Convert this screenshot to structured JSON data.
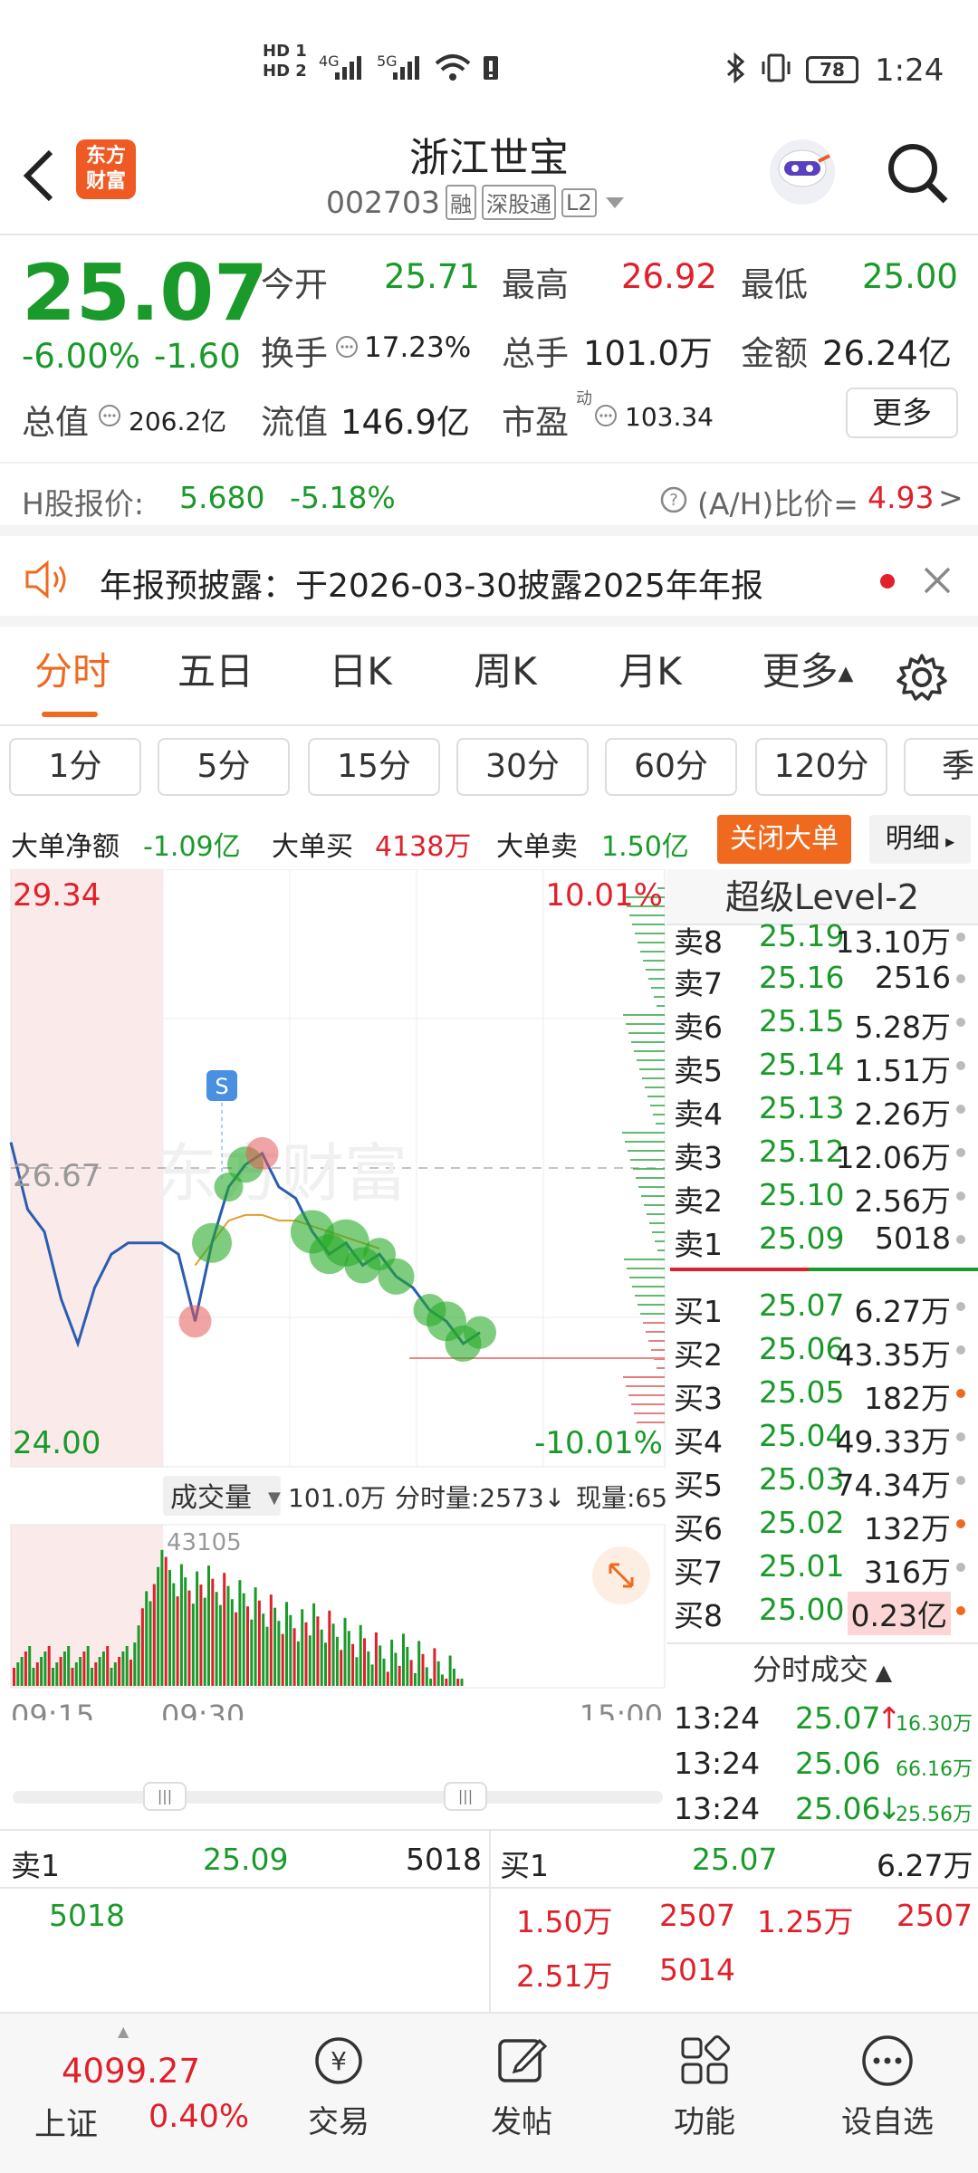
{
  "status": {
    "hd1": "HD 1",
    "hd2": "HD 2",
    "net1": "4G",
    "net2": "5G",
    "battery": "78",
    "time": "1:24"
  },
  "header": {
    "logo_line1": "东方",
    "logo_line2": "财富",
    "stock_name": "浙江世宝",
    "stock_code": "002703",
    "tag_margin": "融",
    "tag_connect": "深股通",
    "tag_level": "L2"
  },
  "quote": {
    "price": "25.07",
    "change_pct": "-6.00%",
    "change": "-1.60",
    "open_label": "今开",
    "open": "25.71",
    "high_label": "最高",
    "high": "26.92",
    "low_label": "最低",
    "low": "25.00",
    "turnover_label": "换手",
    "turnover": "17.23%",
    "volume_label": "总手",
    "volume": "101.0万",
    "amount_label": "金额",
    "amount": "26.24亿",
    "mktcap_label": "总值",
    "mktcap": "206.2亿",
    "float_label": "流值",
    "float": "146.9亿",
    "pe_label": "市盈",
    "pe_sup": "动",
    "pe": "103.34",
    "more_button": "更多"
  },
  "hshare": {
    "label": "H股报价:",
    "price": "5.680",
    "change_pct": "-5.18%",
    "ah_label": "(A/H)比价=",
    "ah_value": "4.93",
    "arrow": ">"
  },
  "notice": {
    "text": "年报预披露：于2026-03-30披露2025年年报"
  },
  "tabs": [
    "分时",
    "五日",
    "日K",
    "周K",
    "月K",
    "更多"
  ],
  "periods": [
    "1分",
    "5分",
    "15分",
    "30分",
    "60分",
    "120分",
    "季"
  ],
  "bigorder": {
    "net_label": "大单净额",
    "net": "-1.09亿",
    "buy_label": "大单买",
    "buy": "4138万",
    "sell_label": "大单卖",
    "sell": "1.50亿",
    "close_button": "关闭大单",
    "detail_button": "明细"
  },
  "chart": {
    "price_top": "29.34",
    "price_bottom": "24.00",
    "price_prev": "26.67",
    "pct_top": "10.01%",
    "pct_bottom": "-10.01%",
    "signal": "S",
    "watermark": "东方财富",
    "vol_label": "成交量",
    "vol_total": "101.0万",
    "vol_tick": "分时量:2573↓",
    "vol_now": "现量:65",
    "vol_max": "43105",
    "time_start": "09:15",
    "time_mid": "09:30",
    "time_end": "15:00",
    "colors": {
      "up": "#e0202a",
      "down": "#1a9a2a",
      "line": "#2a5db0",
      "avg": "#e0a030"
    }
  },
  "chart_data": {
    "type": "line",
    "x_range": [
      "09:15",
      "15:00"
    ],
    "ylim": [
      24.0,
      29.34
    ],
    "prev_close": 26.67,
    "series": [
      {
        "values": [
          26.9,
          26.3,
          26.1,
          25.5,
          25.1,
          25.6,
          25.9,
          26.0,
          26.0,
          26.0,
          25.9,
          25.3,
          26.0,
          26.5,
          26.7,
          26.8,
          26.5,
          26.4,
          26.1,
          25.9,
          26.0,
          25.8,
          25.9,
          25.7,
          25.6,
          25.4,
          25.3,
          25.1,
          25.2
        ]
      },
      {
        "values": [
          null,
          null,
          null,
          null,
          null,
          null,
          null,
          null,
          null,
          null,
          null,
          25.8,
          26.0,
          26.2,
          26.25,
          26.25,
          26.2,
          26.2,
          26.15,
          26.1,
          26.05,
          26.0,
          25.95
        ]
      }
    ]
  },
  "orderbook": {
    "title": "超级Level-2",
    "asks": [
      {
        "label": "卖8",
        "price": "25.19",
        "vol": "13.10万"
      },
      {
        "label": "卖7",
        "price": "25.16",
        "vol": "2516"
      },
      {
        "label": "卖6",
        "price": "25.15",
        "vol": "5.28万"
      },
      {
        "label": "卖5",
        "price": "25.14",
        "vol": "1.51万"
      },
      {
        "label": "卖4",
        "price": "25.13",
        "vol": "2.26万"
      },
      {
        "label": "卖3",
        "price": "25.12",
        "vol": "12.06万"
      },
      {
        "label": "卖2",
        "price": "25.10",
        "vol": "2.56万"
      },
      {
        "label": "卖1",
        "price": "25.09",
        "vol": "5018"
      }
    ],
    "bids": [
      {
        "label": "买1",
        "price": "25.07",
        "vol": "6.27万"
      },
      {
        "label": "买2",
        "price": "25.06",
        "vol": "43.35万"
      },
      {
        "label": "买3",
        "price": "25.05",
        "vol": "182万"
      },
      {
        "label": "买4",
        "price": "25.04",
        "vol": "49.33万"
      },
      {
        "label": "买5",
        "price": "25.03",
        "vol": "74.34万"
      },
      {
        "label": "买6",
        "price": "25.02",
        "vol": "132万"
      },
      {
        "label": "买7",
        "price": "25.01",
        "vol": "316万"
      },
      {
        "label": "买8",
        "price": "25.00",
        "vol": "0.23亿"
      }
    ],
    "ticks_title": "分时成交",
    "ticks": [
      {
        "time": "13:24",
        "price": "25.07",
        "arrow": "↑",
        "vol": "16.30万"
      },
      {
        "time": "13:24",
        "price": "25.06",
        "arrow": "",
        "vol": "66.16万"
      },
      {
        "time": "13:24",
        "price": "25.06",
        "arrow": "↓",
        "vol": "25.56万"
      }
    ]
  },
  "queue": {
    "sell_label": "卖1",
    "sell_price": "25.09",
    "sell_vol": "5018",
    "sell_items": [
      "5018"
    ],
    "buy_label": "买1",
    "buy_price": "25.07",
    "buy_vol": "6.27万",
    "buy_items": [
      "1.50万",
      "2507",
      "1.25万",
      "2507",
      "2.51万",
      "5014"
    ]
  },
  "bottomnav": {
    "index_value": "4099.27",
    "index_name": "上证",
    "index_pct": "0.40%",
    "items": [
      "交易",
      "发帖",
      "功能",
      "设自选"
    ]
  }
}
